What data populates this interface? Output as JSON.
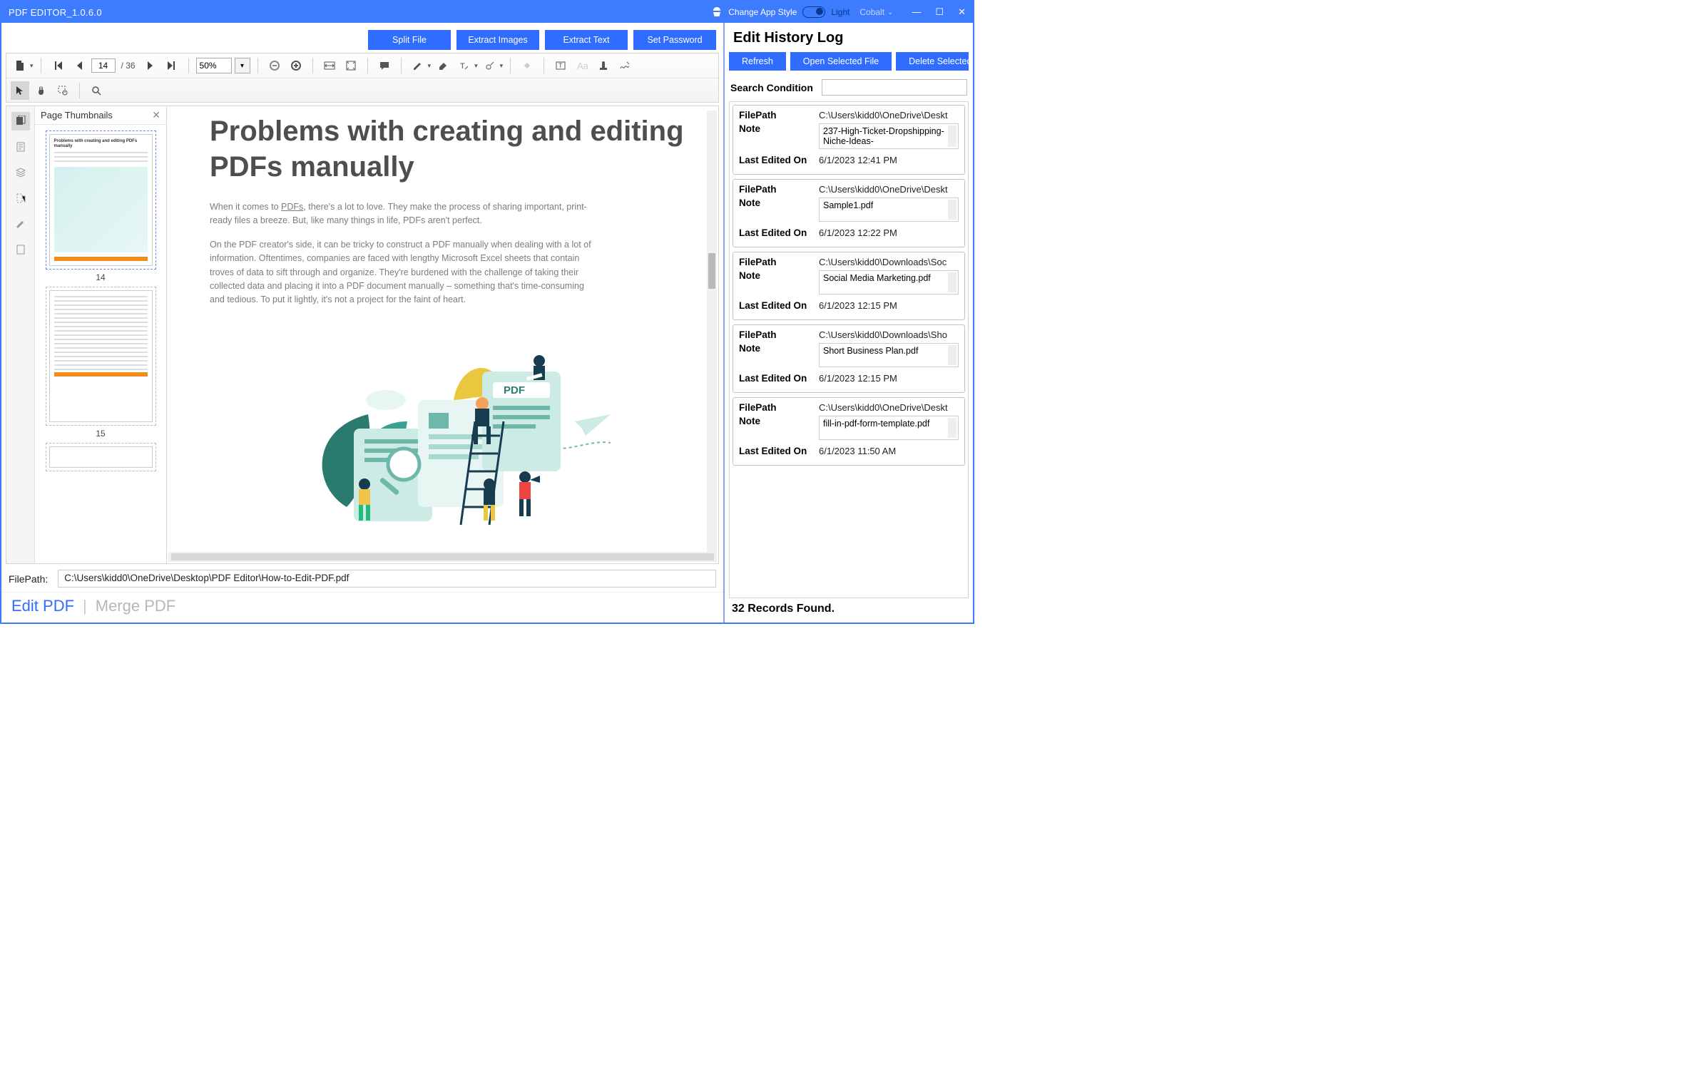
{
  "titlebar": {
    "title": "PDF EDITOR_1.0.6.0",
    "change_style": "Change App Style",
    "light": "Light",
    "theme_name": "Cobalt"
  },
  "actions": {
    "split": "Split File",
    "extract_images": "Extract Images",
    "extract_text": "Extract Text",
    "password": "Set Password"
  },
  "toolbar": {
    "page_current": "14",
    "page_total": "/ 36",
    "zoom": "50%"
  },
  "thumbs": {
    "header": "Page Thumbnails",
    "items": [
      {
        "num": "14",
        "title": "Problems with creating and editing PDFs manually",
        "selected": true,
        "illus": true
      },
      {
        "num": "15",
        "title": "",
        "selected": false,
        "illus": false
      }
    ]
  },
  "doc": {
    "h1": "Problems with creating and editing PDFs manually",
    "p1_a": "When it comes to ",
    "p1_u": "PDFs",
    "p1_b": ", there's a lot to love. They make the process of sharing important, print-ready files a breeze. But, like many things in life, PDFs aren't perfect.",
    "p2": "On the PDF creator's side, it can be tricky to construct a PDF manually when dealing with a lot of information. Oftentimes, companies are faced with lengthy Microsoft Excel sheets that contain troves of data to sift through and organize. They're burdened with the challenge of taking their collected data and placing it into a PDF document manually – something that's time-consuming and tedious. To put it lightly, it's not a project for the faint of heart.",
    "pdf_tag": "PDF"
  },
  "filepath": {
    "label": "FilePath:",
    "value": "C:\\Users\\kidd0\\OneDrive\\Desktop\\PDF Editor\\How-to-Edit-PDF.pdf"
  },
  "tabs": {
    "edit": "Edit PDF",
    "merge": "Merge PDF"
  },
  "history": {
    "title": "Edit History Log",
    "refresh": "Refresh",
    "open": "Open Selected File",
    "delete": "Delete Selected",
    "search_label": "Search Condition",
    "labels": {
      "filepath": "FilePath",
      "note": "Note",
      "edited": "Last Edited On"
    },
    "items": [
      {
        "filepath": "C:\\Users\\kidd0\\OneDrive\\Deskt",
        "note": "237-High-Ticket-Dropshipping-Niche-Ideas-",
        "edited": "6/1/2023 12:41 PM"
      },
      {
        "filepath": "C:\\Users\\kidd0\\OneDrive\\Deskt",
        "note": "Sample1.pdf",
        "edited": "6/1/2023 12:22 PM"
      },
      {
        "filepath": "C:\\Users\\kidd0\\Downloads\\Soc",
        "note": "Social Media Marketing.pdf",
        "edited": "6/1/2023 12:15 PM"
      },
      {
        "filepath": "C:\\Users\\kidd0\\Downloads\\Sho",
        "note": "Short Business Plan.pdf",
        "edited": "6/1/2023 12:15 PM"
      },
      {
        "filepath": "C:\\Users\\kidd0\\OneDrive\\Deskt",
        "note": "fill-in-pdf-form-template.pdf",
        "edited": "6/1/2023 11:50 AM"
      }
    ],
    "footer": "32 Records Found."
  }
}
